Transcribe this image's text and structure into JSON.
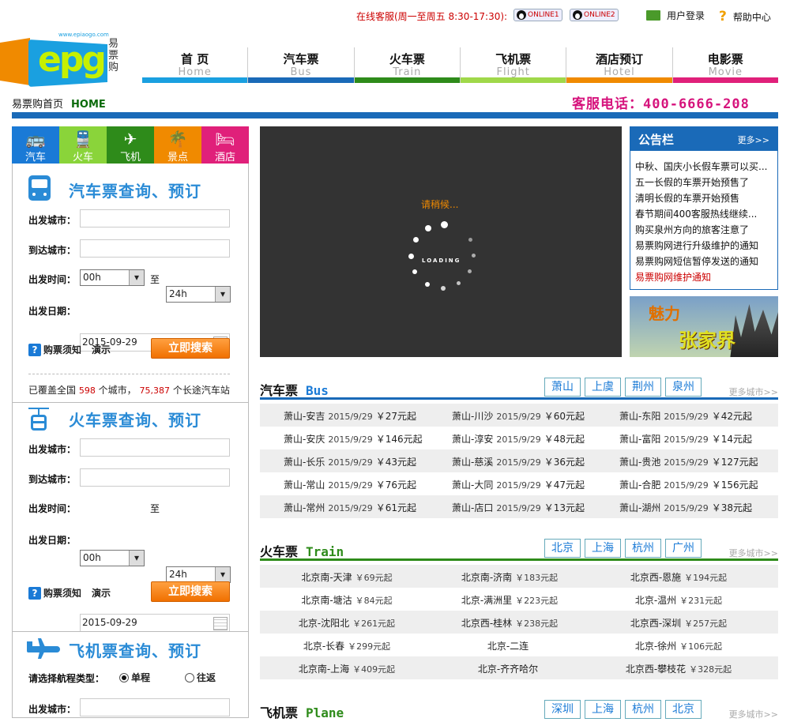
{
  "topbar": {
    "service_text": "在线客服(周一至周五 8:30-17:30):",
    "qq1": "ONLINE1",
    "qq2": "ONLINE2",
    "login": "用户登录",
    "help": "帮助中心"
  },
  "logo": {
    "letters": "epg",
    "cn": "易票购",
    "url": "www.epiaogo.com"
  },
  "nav": [
    {
      "cn": "首 页",
      "en": "Home",
      "color": "#1aa0e0"
    },
    {
      "cn": "汽车票",
      "en": "Bus",
      "color": "#1a6ab8"
    },
    {
      "cn": "火车票",
      "en": "Train",
      "color": "#2e8b1a"
    },
    {
      "cn": "飞机票",
      "en": "Flight",
      "color": "#a0d84a"
    },
    {
      "cn": "酒店预订",
      "en": "Hotel",
      "color": "#f08a00"
    },
    {
      "cn": "电影票",
      "en": "Movie",
      "color": "#e0207a"
    }
  ],
  "breadcrumb": {
    "site": "易票购首页",
    "home": "HOME"
  },
  "hotline": "客服电话：400-6666-208",
  "tabs": [
    {
      "label": "汽车",
      "icon": "bus-icon",
      "glyph": "🚌",
      "color": "#1a7ad6"
    },
    {
      "label": "火车",
      "icon": "train-icon",
      "glyph": "🚆",
      "color": "#8ad43a"
    },
    {
      "label": "飞机",
      "icon": "plane-icon",
      "glyph": "✈",
      "color": "#2e8b1a"
    },
    {
      "label": "景点",
      "icon": "palm-tree-icon",
      "glyph": "🌴",
      "color": "#f08a00"
    },
    {
      "label": "酒店",
      "icon": "bed-icon",
      "glyph": "🛏",
      "color": "#e0207a"
    }
  ],
  "bus_form": {
    "title": "汽车票查询、预订",
    "from_label": "出发城市：",
    "to_label": "到达城市：",
    "time_label": "出发时间：",
    "time_from": "00h",
    "to_word": "至",
    "time_to": "24h",
    "date_label": "出发日期：",
    "date": "2015-09-29",
    "notice": "购票须知",
    "demo": "演示",
    "search": "立即搜索",
    "coverage_a": "已覆盖全国",
    "coverage_cities": "598",
    "coverage_b": "个城市，",
    "coverage_stations": "75,387",
    "coverage_c": "个长途汽车站"
  },
  "train_form": {
    "title": "火车票查询、预订",
    "from_label": "出发城市：",
    "to_label": "到达城市：",
    "time_label": "出发时间：",
    "time_from": "00h",
    "to_word": "至",
    "time_to": "24h",
    "date_label": "出发日期：",
    "date": "2015-09-29",
    "notice": "购票须知",
    "demo": "演示",
    "search": "立即搜索"
  },
  "flight_form": {
    "title": "飞机票查询、预订",
    "type_label": "请选择航程类型：",
    "one_way": "单程",
    "round_trip": "往返",
    "from_label": "出发城市："
  },
  "video": {
    "wait": "请稍候...",
    "loading": "LOADING"
  },
  "notice": {
    "title": "公告栏",
    "more": "更多>>",
    "items": [
      "中秋、国庆小长假车票可以买...",
      "五一长假的车票开始预售了",
      "清明长假的车票开始预售",
      "春节期间400客服热线继续...",
      "购买泉州方向的旅客注意了",
      "易票购网进行升级维护的通知",
      "易票购网短信暂停发送的通知",
      "易票购网维护通知"
    ]
  },
  "banner": {
    "a": "魅力",
    "b": "张家界"
  },
  "bus": {
    "title": "汽车票",
    "en": "Bus",
    "cities": [
      "萧山",
      "上虞",
      "荆州",
      "泉州"
    ],
    "more": "更多城市>>",
    "rows": [
      [
        [
          "萧山-安吉",
          "2015/9/29",
          "￥27元起"
        ],
        [
          "萧山-川沙",
          "2015/9/29",
          "￥60元起"
        ],
        [
          "萧山-东阳",
          "2015/9/29",
          "￥42元起"
        ]
      ],
      [
        [
          "萧山-安庆",
          "2015/9/29",
          "￥146元起"
        ],
        [
          "萧山-淳安",
          "2015/9/29",
          "￥48元起"
        ],
        [
          "萧山-富阳",
          "2015/9/29",
          "￥14元起"
        ]
      ],
      [
        [
          "萧山-长乐",
          "2015/9/29",
          "￥43元起"
        ],
        [
          "萧山-慈溪",
          "2015/9/29",
          "￥36元起"
        ],
        [
          "萧山-贵池",
          "2015/9/29",
          "￥127元起"
        ]
      ],
      [
        [
          "萧山-常山",
          "2015/9/29",
          "￥76元起"
        ],
        [
          "萧山-大同",
          "2015/9/29",
          "￥47元起"
        ],
        [
          "萧山-合肥",
          "2015/9/29",
          "￥156元起"
        ]
      ],
      [
        [
          "萧山-常州",
          "2015/9/29",
          "￥61元起"
        ],
        [
          "萧山-店口",
          "2015/9/29",
          "￥13元起"
        ],
        [
          "萧山-湖州",
          "2015/9/29",
          "￥38元起"
        ]
      ]
    ]
  },
  "train": {
    "title": "火车票",
    "en": "Train",
    "cities": [
      "北京",
      "上海",
      "杭州",
      "广州"
    ],
    "more": "更多城市>>",
    "rows": [
      [
        [
          "北京南-天津",
          "￥69元起"
        ],
        [
          "北京南-济南",
          "￥183元起"
        ],
        [
          "北京西-恩施",
          "￥194元起"
        ]
      ],
      [
        [
          "北京南-塘沽",
          "￥84元起"
        ],
        [
          "北京-满洲里",
          "￥223元起"
        ],
        [
          "北京-温州",
          "￥231元起"
        ]
      ],
      [
        [
          "北京-沈阳北",
          "￥261元起"
        ],
        [
          "北京西-桂林",
          "￥238元起"
        ],
        [
          "北京西-深圳",
          "￥257元起"
        ]
      ],
      [
        [
          "北京-长春",
          "￥299元起"
        ],
        [
          "北京-二连",
          ""
        ],
        [
          "北京-徐州",
          "￥106元起"
        ]
      ],
      [
        [
          "北京南-上海",
          "￥409元起"
        ],
        [
          "北京-齐齐哈尔",
          ""
        ],
        [
          "北京西-攀枝花",
          "￥328元起"
        ]
      ]
    ]
  },
  "plane": {
    "title": "飞机票",
    "en": "Plane",
    "cities": [
      "深圳",
      "上海",
      "杭州",
      "北京"
    ],
    "more": "更多城市>>"
  }
}
